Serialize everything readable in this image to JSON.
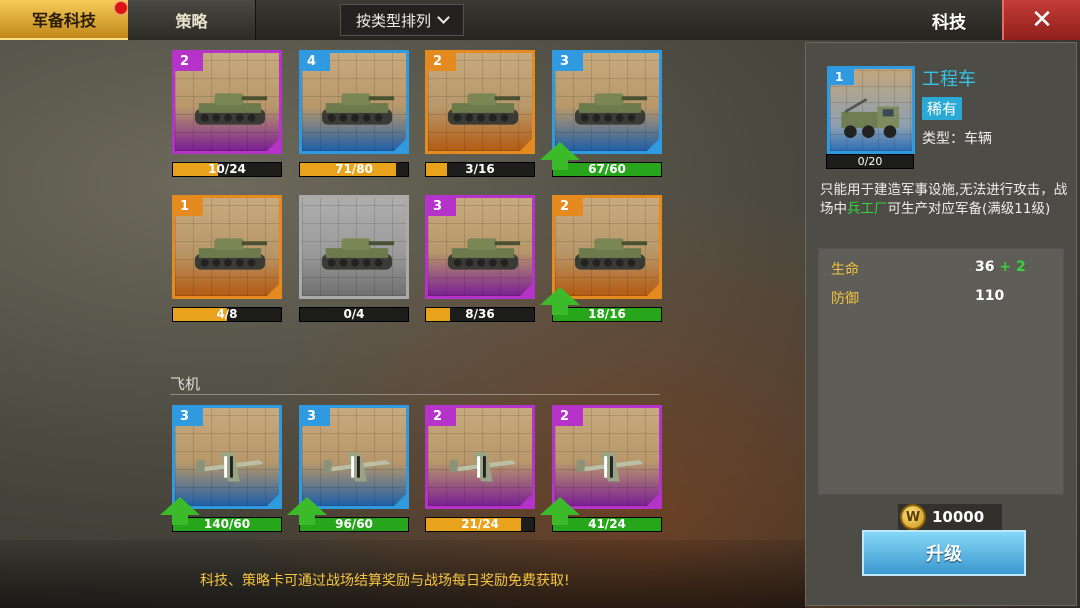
{
  "tabs": [
    {
      "label": "军备科技"
    },
    {
      "label": "策略"
    }
  ],
  "sort_label": "按类型排列",
  "window_title": "科技",
  "section_aircraft": "飞机",
  "cards": [
    {
      "level": "2",
      "progress": "10/24",
      "fill": 0.42,
      "rarity": "purple",
      "kind": "tank",
      "upgrade": false
    },
    {
      "level": "4",
      "progress": "71/80",
      "fill": 0.89,
      "rarity": "blue",
      "kind": "tank",
      "upgrade": false
    },
    {
      "level": "2",
      "progress": "3/16",
      "fill": 0.19,
      "rarity": "orange",
      "kind": "tank",
      "upgrade": false
    },
    {
      "level": "3",
      "progress": "67/60",
      "fill": 1.0,
      "rarity": "blue",
      "kind": "tank",
      "upgrade": true
    },
    {
      "level": "1",
      "progress": "4/8",
      "fill": 0.5,
      "rarity": "orange",
      "kind": "tank",
      "upgrade": false
    },
    {
      "level": "",
      "progress": "0/4",
      "fill": 0.0,
      "rarity": "gray",
      "kind": "tank",
      "upgrade": false
    },
    {
      "level": "3",
      "progress": "8/36",
      "fill": 0.22,
      "rarity": "purple",
      "kind": "tank",
      "upgrade": false
    },
    {
      "level": "2",
      "progress": "18/16",
      "fill": 1.0,
      "rarity": "orange",
      "kind": "tank",
      "upgrade": true
    },
    {
      "level": "3",
      "progress": "140/60",
      "fill": 1.0,
      "rarity": "blue",
      "kind": "plane",
      "upgrade": true
    },
    {
      "level": "3",
      "progress": "96/60",
      "fill": 1.0,
      "rarity": "blue",
      "kind": "plane",
      "upgrade": true
    },
    {
      "level": "2",
      "progress": "21/24",
      "fill": 0.88,
      "rarity": "purple",
      "kind": "plane",
      "upgrade": false
    },
    {
      "level": "2",
      "progress": "41/24",
      "fill": 1.0,
      "rarity": "purple",
      "kind": "plane",
      "upgrade": true
    }
  ],
  "bottom_tip": "科技、策略卡可通过战场结算奖励与战场每日奖励免费获取!",
  "panel": {
    "level": "1",
    "progress": "0/20",
    "name": "工程车",
    "rarity": "稀有",
    "type": "类型：车辆",
    "desc_1": "只能用于建造军事设施,无法进行攻击，战场中",
    "desc_hl": "兵工厂",
    "desc_2": "可生产对应军备(满级11级)",
    "stats": [
      {
        "label": "生命",
        "value": "36",
        "bonus": "+ 2"
      },
      {
        "label": "防御",
        "value": "110",
        "bonus": ""
      }
    ],
    "coin_symbol": "W",
    "cost": "10000",
    "upgrade_label": "升级"
  },
  "colors": {
    "orange": "#e58a1e",
    "purple": "#b533c8",
    "blue": "#2f9ae0",
    "green": "#3bbb2a",
    "gold": "#f5c542"
  },
  "icons": {
    "close": "close-icon",
    "sort": "chevron-down-icon",
    "coin": "coin-icon",
    "upgrade_arrow": "arrow-up-icon"
  }
}
